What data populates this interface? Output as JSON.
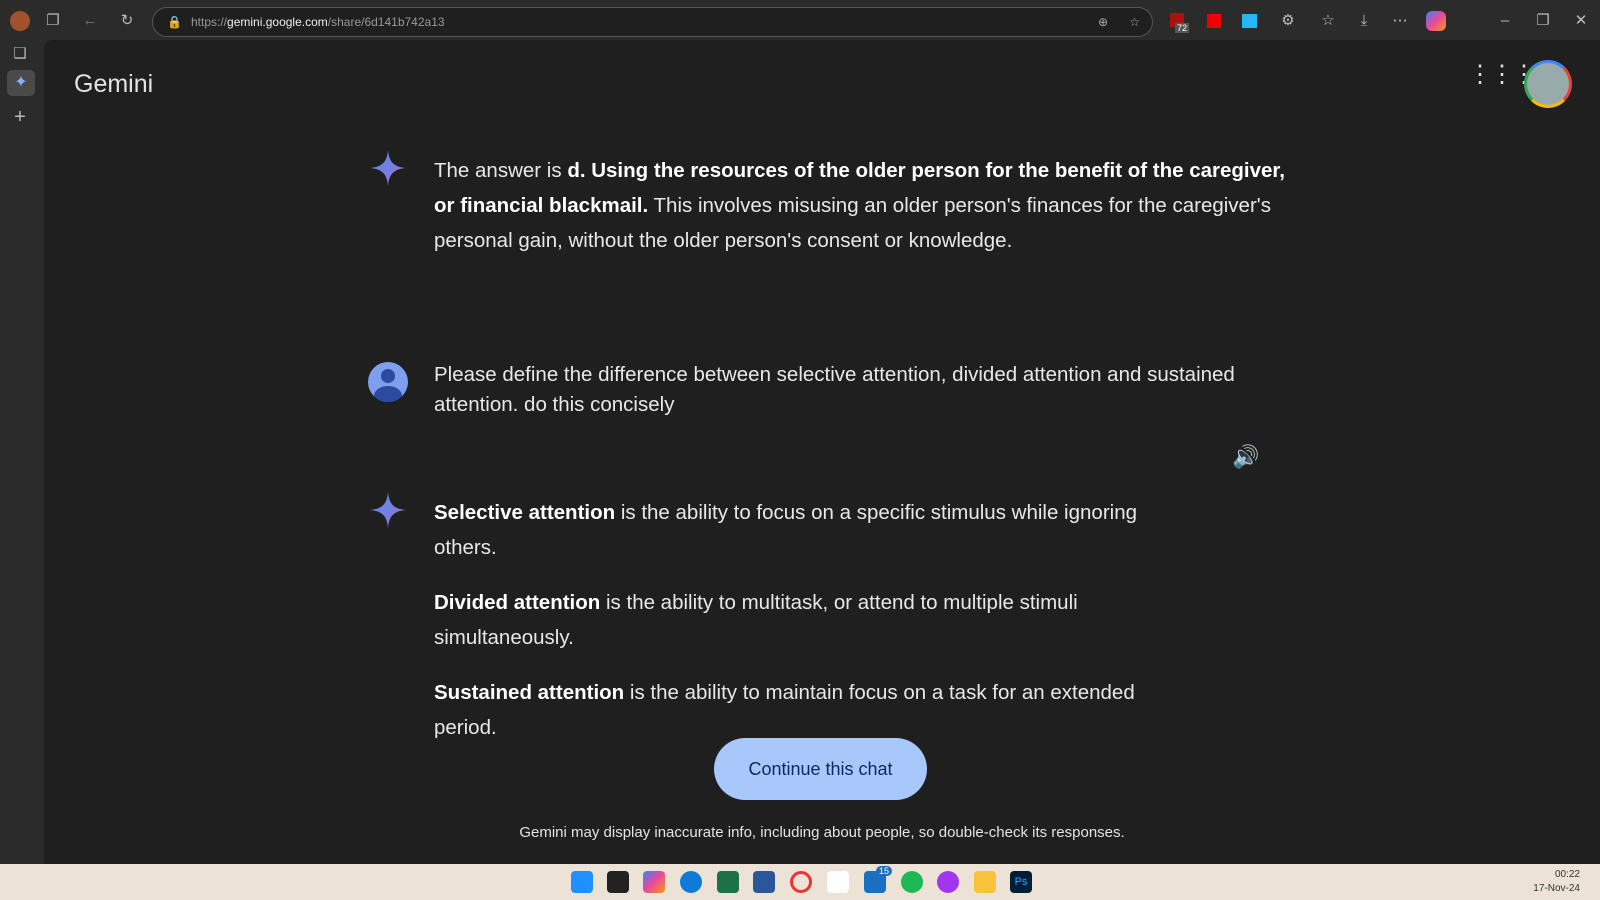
{
  "browser": {
    "url_prefix": "https://",
    "url_domain": "gemini.google.com",
    "url_path": "/share/6d141b742a13",
    "extension_badge": "72"
  },
  "app": {
    "title": "Gemini"
  },
  "conversation": [
    {
      "role": "model",
      "parts": [
        {
          "text": "The answer is ",
          "bold": false
        },
        {
          "text": "d. Using the resources of the older person for the benefit of the caregiver, or financial blackmail.",
          "bold": true
        },
        {
          "text": " This involves misusing an older person's finances for the caregiver's personal gain, without the older person's consent or knowledge.",
          "bold": false
        }
      ]
    },
    {
      "role": "user",
      "text": "Please define the difference between selective attention, divided attention and sustained attention.  do this concisely"
    },
    {
      "role": "model",
      "paragraphs": [
        {
          "term": "Selective attention",
          "rest": " is the ability to focus on a specific stimulus while ignoring others."
        },
        {
          "term": "Divided attention",
          "rest": " is the ability to multitask, or attend to multiple stimuli simultaneously."
        },
        {
          "term": "Sustained attention",
          "rest": " is the ability to maintain focus on a task for an extended period."
        }
      ]
    }
  ],
  "continue_label": "Continue this chat",
  "disclaimer": "Gemini may display inaccurate info, including about people, so double-check its responses.",
  "taskbar": {
    "time": "00:22",
    "date": "17-Nov-24",
    "teams_badge": "15"
  },
  "colors": {
    "accent": "#a8c7fa",
    "background": "#1f1f1f"
  }
}
